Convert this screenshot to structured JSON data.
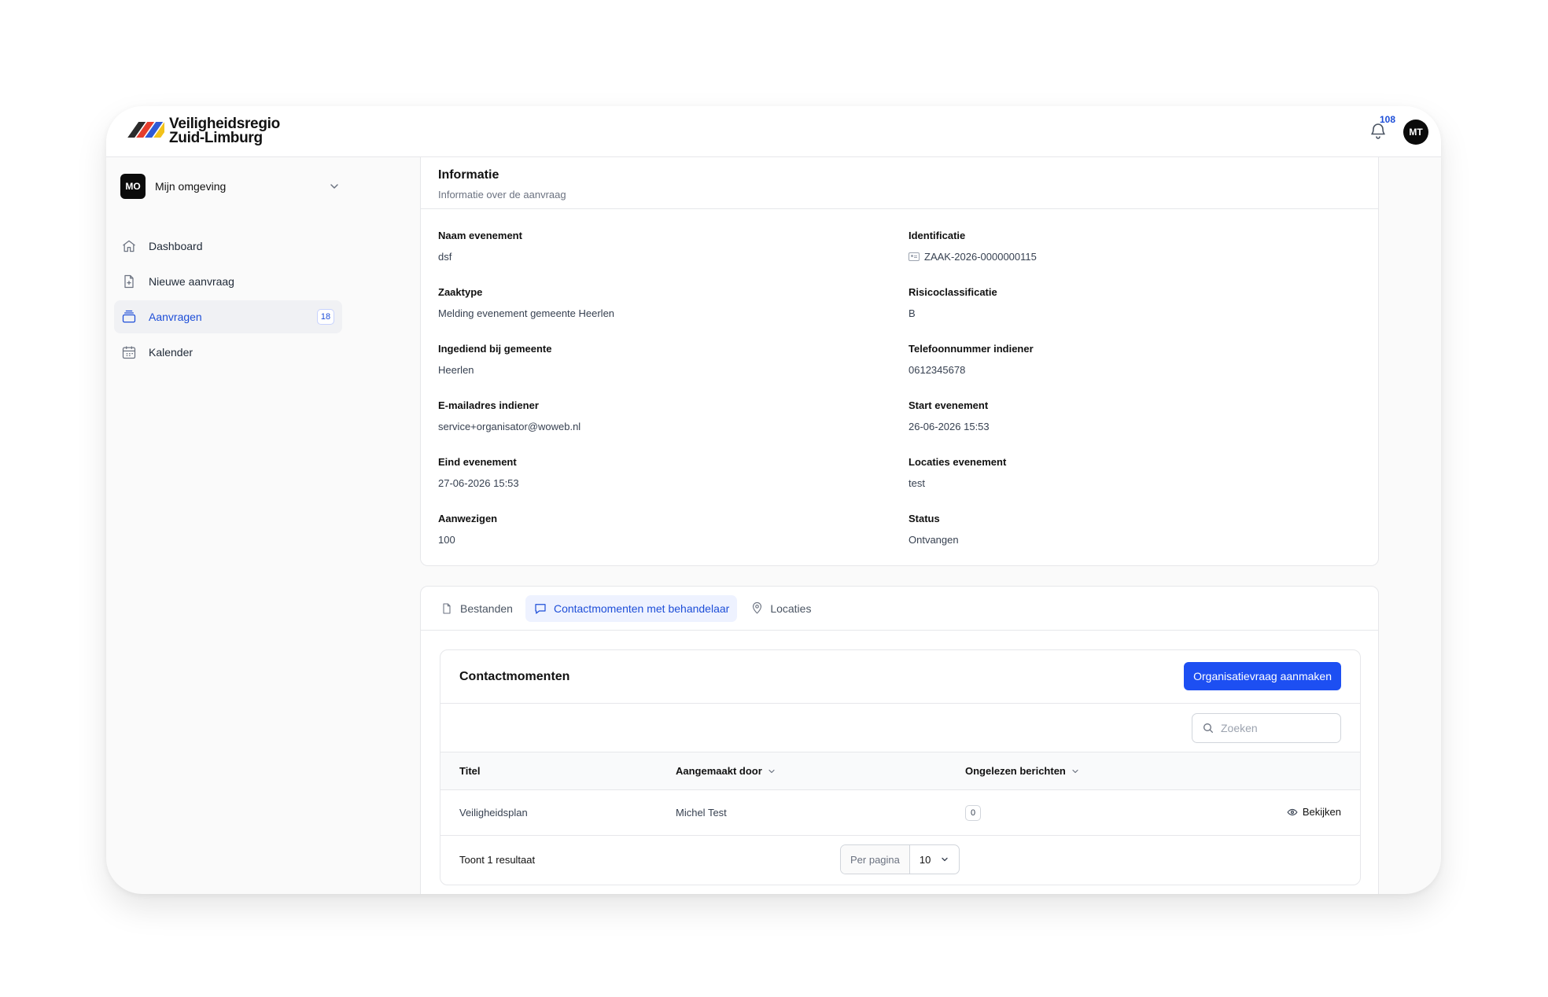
{
  "brand": {
    "line1": "Veiligheidsregio",
    "line2": "Zuid-Limburg"
  },
  "header": {
    "notification_count": "108",
    "user_initials": "MT"
  },
  "sidebar": {
    "environment": {
      "badge": "MO",
      "label": "Mijn omgeving"
    },
    "items": [
      {
        "label": "Dashboard",
        "icon": "home-icon"
      },
      {
        "label": "Nieuwe aanvraag",
        "icon": "file-plus-icon"
      },
      {
        "label": "Aanvragen",
        "icon": "inbox-stack-icon",
        "count": "18",
        "active": true
      },
      {
        "label": "Kalender",
        "icon": "calendar-icon"
      }
    ]
  },
  "info": {
    "title": "Informatie",
    "subtitle": "Informatie over de aanvraag",
    "fields": [
      {
        "label": "Naam evenement",
        "value": "dsf"
      },
      {
        "label": "Identificatie",
        "value": "ZAAK-2026-0000000115"
      },
      {
        "label": "Zaaktype",
        "value": "Melding evenement gemeente Heerlen"
      },
      {
        "label": "Risicoclassificatie",
        "value": "B"
      },
      {
        "label": "Ingediend bij gemeente",
        "value": "Heerlen"
      },
      {
        "label": "Telefoonnummer indiener",
        "value": "0612345678"
      },
      {
        "label": "E-mailadres indiener",
        "value": "service+organisator@woweb.nl"
      },
      {
        "label": "Start evenement",
        "value": "26-06-2026 15:53"
      },
      {
        "label": "Eind evenement",
        "value": "27-06-2026 15:53"
      },
      {
        "label": "Locaties evenement",
        "value": "test"
      },
      {
        "label": "Aanwezigen",
        "value": "100"
      },
      {
        "label": "Status",
        "value": "Ontvangen"
      }
    ]
  },
  "tabs": [
    {
      "label": "Bestanden",
      "icon": "document-icon"
    },
    {
      "label": "Contactmomenten met behandelaar",
      "icon": "chat-bubble-icon",
      "active": true
    },
    {
      "label": "Locaties",
      "icon": "map-pin-icon"
    }
  ],
  "contact": {
    "title": "Contactmomenten",
    "create_button": "Organisatievraag aanmaken",
    "search_placeholder": "Zoeken",
    "columns": {
      "title": "Titel",
      "created_by": "Aangemaakt door",
      "unread": "Ongelezen berichten"
    },
    "rows": [
      {
        "title": "Veiligheidsplan",
        "created_by": "Michel Test",
        "unread": "0",
        "action": "Bekijken"
      }
    ],
    "footer": {
      "result_text": "Toont 1 resultaat",
      "per_page_label": "Per pagina",
      "per_page_value": "10"
    }
  },
  "colors": {
    "accent": "#1d4ff2",
    "active_text": "#1d4ed8"
  }
}
